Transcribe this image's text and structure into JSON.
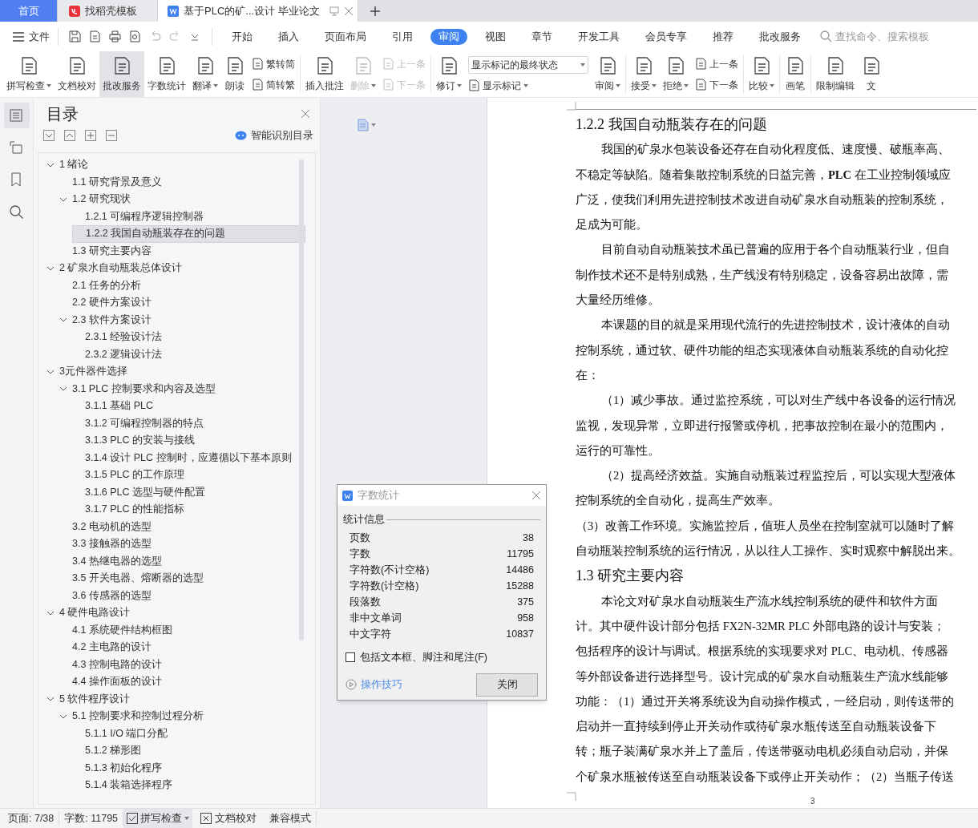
{
  "tabs": [
    {
      "kind": "home",
      "label": "首页",
      "selected": false
    },
    {
      "kind": "web",
      "label": "找稻壳模板",
      "selected": false
    },
    {
      "kind": "document",
      "label": "基于PLC的矿...设计 毕业论文",
      "selected": true
    }
  ],
  "menu": {
    "file": "文件",
    "tabs": [
      {
        "label": "开始",
        "selected": false
      },
      {
        "label": "插入",
        "selected": false
      },
      {
        "label": "页面布局",
        "selected": false
      },
      {
        "label": "引用",
        "selected": false
      },
      {
        "label": "审阅",
        "selected": true
      },
      {
        "label": "视图",
        "selected": false
      },
      {
        "label": "章节",
        "selected": false
      },
      {
        "label": "开发工具",
        "selected": false
      },
      {
        "label": "会员专享",
        "selected": false
      },
      {
        "label": "推荐",
        "selected": false
      },
      {
        "label": "批改服务",
        "selected": false
      }
    ],
    "search": {
      "placeholder": "查找命令、搜索模板"
    }
  },
  "ribbon": [
    {
      "kind": "large",
      "label": "拼写检查",
      "caret": true,
      "selected": false,
      "disabled": false
    },
    {
      "kind": "large",
      "label": "文档校对",
      "caret": false,
      "selected": false,
      "disabled": false
    },
    {
      "kind": "large",
      "label": "批改服务",
      "caret": false,
      "selected": true,
      "disabled": false
    },
    {
      "kind": "large",
      "label": "字数统计",
      "caret": false,
      "selected": false,
      "disabled": false
    },
    {
      "kind": "large",
      "label": "翻译",
      "caret": true,
      "selected": false,
      "disabled": false
    },
    {
      "kind": "large",
      "label": "朗读",
      "caret": false,
      "selected": false,
      "disabled": false
    },
    {
      "kind": "stack",
      "items": [
        {
          "label": "繁转简",
          "caret": false,
          "disabled": false
        },
        {
          "label": "简转繁",
          "caret": false,
          "disabled": false
        }
      ]
    },
    {
      "kind": "separator"
    },
    {
      "kind": "large",
      "label": "插入批注",
      "caret": false,
      "selected": false,
      "disabled": false
    },
    {
      "kind": "large",
      "label": "删除",
      "caret": true,
      "selected": false,
      "disabled": true
    },
    {
      "kind": "stack",
      "items": [
        {
          "label": "上一条",
          "caret": false,
          "disabled": true
        },
        {
          "label": "下一条",
          "caret": false,
          "disabled": true
        }
      ]
    },
    {
      "kind": "separator"
    },
    {
      "kind": "large",
      "label": "修订",
      "caret": true,
      "selected": false,
      "disabled": false
    },
    {
      "kind": "dropdown",
      "value": "显示标记的最终状态",
      "below": {
        "label": "显示标记",
        "caret": true,
        "disabled": false
      }
    },
    {
      "kind": "large",
      "label": "审阅",
      "caret": true,
      "selected": false,
      "disabled": false
    },
    {
      "kind": "separator"
    },
    {
      "kind": "large",
      "label": "接受",
      "caret": true,
      "selected": false,
      "disabled": false
    },
    {
      "kind": "large",
      "label": "拒绝",
      "caret": true,
      "selected": false,
      "disabled": false
    },
    {
      "kind": "stack",
      "items": [
        {
          "label": "上一条",
          "caret": false,
          "disabled": false
        },
        {
          "label": "下一条",
          "caret": false,
          "disabled": false
        }
      ]
    },
    {
      "kind": "separator"
    },
    {
      "kind": "large",
      "label": "比较",
      "caret": true,
      "selected": false,
      "disabled": false
    },
    {
      "kind": "separator"
    },
    {
      "kind": "large",
      "label": "画笔",
      "caret": false,
      "selected": false,
      "disabled": false
    },
    {
      "kind": "separator"
    },
    {
      "kind": "large",
      "label": "限制编辑",
      "caret": false,
      "selected": false,
      "disabled": false
    },
    {
      "kind": "large",
      "label": "文",
      "caret": false,
      "selected": false,
      "disabled": false
    }
  ],
  "rail": [
    {
      "selected": true
    },
    {
      "selected": false
    },
    {
      "selected": false
    },
    {
      "selected": false
    }
  ],
  "toc": {
    "title": "目录",
    "smart": "智能识别目录",
    "items": [
      {
        "label": "1  绪论",
        "selected": false,
        "expanded": true,
        "children": [
          {
            "label": "1.1 研究背景及意义",
            "selected": false
          },
          {
            "label": "1.2 研究现状",
            "selected": false,
            "expanded": true,
            "children": [
              {
                "label": "1.2.1  可编程序逻辑控制器",
                "selected": false
              },
              {
                "label": "1.2.2  我国自动瓶装存在的问题",
                "selected": true
              }
            ]
          },
          {
            "label": "1.3 研究主要内容",
            "selected": false
          }
        ]
      },
      {
        "label": "2  矿泉水自动瓶装总体设计",
        "selected": false,
        "expanded": true,
        "children": [
          {
            "label": "2.1 任务的分析",
            "selected": false
          },
          {
            "label": "2.2 硬件方案设计",
            "selected": false
          },
          {
            "label": "2.3 软件方案设计",
            "selected": false,
            "expanded": true,
            "children": [
              {
                "label": "2.3.1 经验设计法",
                "selected": false
              },
              {
                "label": "2.3.2 逻辑设计法",
                "selected": false
              }
            ]
          }
        ]
      },
      {
        "label": "3元件器件选择",
        "selected": false,
        "expanded": true,
        "children": [
          {
            "label": "3.1 PLC 控制要求和内容及选型",
            "selected": false,
            "expanded": true,
            "children": [
              {
                "label": "3.1.1 基础 PLC",
                "selected": false
              },
              {
                "label": "3.1.2 可编程控制器的特点",
                "selected": false
              },
              {
                "label": "3.1.3 PLC 的安装与接线",
                "selected": false
              },
              {
                "label": "3.1.4 设计 PLC 控制时，应遵循以下基本原则",
                "selected": false
              },
              {
                "label": "3.1.5 PLC 的工作原理",
                "selected": false
              },
              {
                "label": "3.1.6 PLC 选型与硬件配置",
                "selected": false
              },
              {
                "label": "3.1.7 PLC 的性能指标",
                "selected": false
              }
            ]
          },
          {
            "label": "3.2 电动机的选型",
            "selected": false
          },
          {
            "label": "3.3 接触器的选型",
            "selected": false
          },
          {
            "label": "3.4 热继电器的选型",
            "selected": false
          },
          {
            "label": "3.5 开关电器、熔断器的选型",
            "selected": false
          },
          {
            "label": "3.6 传感器的选型",
            "selected": false
          }
        ]
      },
      {
        "label": "4  硬件电路设计",
        "selected": false,
        "expanded": true,
        "children": [
          {
            "label": "4.1 系统硬件结构框图",
            "selected": false
          },
          {
            "label": "4.2 主电路的设计",
            "selected": false
          },
          {
            "label": "4.3 控制电路的设计",
            "selected": false
          },
          {
            "label": "4.4 操作面板的设计",
            "selected": false
          }
        ]
      },
      {
        "label": "5  软件程序设计",
        "selected": false,
        "expanded": true,
        "children": [
          {
            "label": "5.1 控制要求和控制过程分析",
            "selected": false,
            "expanded": true,
            "children": [
              {
                "label": "5.1.1 I/O 端口分配",
                "selected": false
              },
              {
                "label": "5.1.2 梯形图",
                "selected": false
              },
              {
                "label": "5.1.3 初始化程序",
                "selected": false
              },
              {
                "label": "5.1.4 装箱选择程序",
                "selected": false
              }
            ]
          }
        ]
      }
    ]
  },
  "document": {
    "page_number": "3",
    "lines": [
      {
        "kind": "title",
        "text": "1.2.2  我国自动瓶装存在的问题"
      },
      {
        "kind": "indent",
        "text": "我国的矿泉水包装设备还存在自动化程度低、速度慢、破瓶率高、"
      },
      {
        "kind": "flush",
        "text": "不稳定等缺陷。随着集散控制系统的日益完善，**PLC** 在工业控制领域应"
      },
      {
        "kind": "flush",
        "text": "广泛，使我们利用先进控制技术改进自动矿泉水自动瓶装的控制系统，"
      },
      {
        "kind": "flush",
        "text": "足成为可能。"
      },
      {
        "kind": "indent",
        "text": "目前自动自动瓶装技术虽已普遍的应用于各个自动瓶装行业，但自"
      },
      {
        "kind": "flush",
        "text": "制作技术还不是特别成熟，生产线没有特别稳定，设备容易出故障，需"
      },
      {
        "kind": "flush",
        "text": "大量经历维修。"
      },
      {
        "kind": "indent",
        "text": "本课题的目的就是采用现代流行的先进控制技术，设计液体的自动"
      },
      {
        "kind": "flush",
        "text": "控制系统，通过软、硬件功能的组态实现液体自动瓶装系统的自动化控"
      },
      {
        "kind": "flush",
        "text": "在："
      },
      {
        "kind": "indent",
        "text": "（1）减少事故。通过监控系统，可以对生产线中各设备的运行情况"
      },
      {
        "kind": "flush",
        "text": "监视，发现异常，立即进行报警或停机，把事故控制在最小的范围内，"
      },
      {
        "kind": "flush",
        "text": "运行的可靠性。"
      },
      {
        "kind": "indent",
        "text": "（2）提高经济效益。实施自动瓶装过程监控后，可以实现大型液体"
      },
      {
        "kind": "flush",
        "text": "控制系统的全自动化，提高生产效率。"
      },
      {
        "kind": "flush",
        "text": "（3）改善工作环境。实施监控后，值班人员坐在控制室就可以随时了解"
      },
      {
        "kind": "flush",
        "text": "自动瓶装控制系统的运行情况，从以往人工操作、实时观察中解脱出来。"
      },
      {
        "kind": "heading",
        "text": "1.3 研究主要内容"
      },
      {
        "kind": "indent",
        "text": "本论文对矿泉水自动瓶装生产流水线控制系统的硬件和软件方面"
      },
      {
        "kind": "flush",
        "text": "计。其中硬件设计部分包括 FX2N-32MR PLC 外部电路的设计与安装；"
      },
      {
        "kind": "flush",
        "text": "包括程序的设计与调试。根据系统的实现要求对 PLC、电动机、传感器"
      },
      {
        "kind": "flush",
        "text": "等外部设备进行选择型号。设计完成的矿泉水自动瓶装生产流水线能够"
      },
      {
        "kind": "flush",
        "text": "功能：（1）通过开关将系统设为自动操作模式，一经启动，则传送带的"
      },
      {
        "kind": "flush",
        "text": "启动并一直持续到停止开关动作或待矿泉水瓶传送至自动瓶装设备下"
      },
      {
        "kind": "flush",
        "text": "转；瓶子装满矿泉水并上了盖后，传送带驱动电机必须自动启动，并保"
      },
      {
        "kind": "flush",
        "text": "个矿泉水瓶被传送至自动瓶装设备下或停止开关动作；（2）当瓶子传送"
      }
    ]
  },
  "dialog": {
    "title": "字数统计",
    "section": "统计信息",
    "rows": [
      {
        "label": "页数",
        "value": "38"
      },
      {
        "label": "字数",
        "value": "11795"
      },
      {
        "label": "字符数(不计空格)",
        "value": "14486"
      },
      {
        "label": "字符数(计空格)",
        "value": "15288"
      },
      {
        "label": "段落数",
        "value": "375"
      },
      {
        "label": "非中文单词",
        "value": "958"
      },
      {
        "label": "中文字符",
        "value": "10837"
      }
    ],
    "checkbox": {
      "label": "包括文本框、脚注和尾注(F)",
      "checked": false
    },
    "tips": "操作技巧",
    "close": "关闭"
  },
  "status_bar": [
    {
      "kind": "text",
      "label": "页面: 7/38"
    },
    {
      "kind": "text",
      "label": "字数: 11795"
    },
    {
      "kind": "check",
      "label": "拼写检查",
      "caret": true
    },
    {
      "kind": "proof",
      "label": "文档校对"
    },
    {
      "kind": "text",
      "label": "兼容模式"
    }
  ]
}
